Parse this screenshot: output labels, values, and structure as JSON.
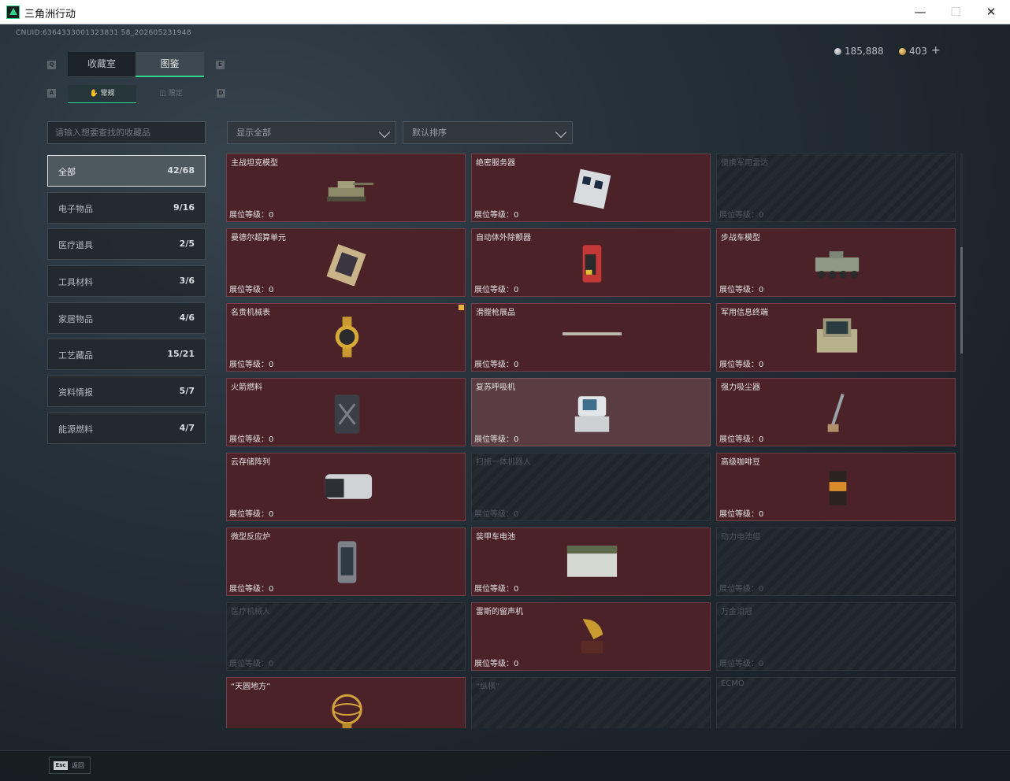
{
  "window": {
    "title": "三角洲行动"
  },
  "header": {
    "uid": "CNUID:6364333001323831 58_202605231948",
    "currency_silver": "185,888",
    "currency_gold": "403",
    "add_label": "+"
  },
  "tabs": {
    "collection": "收藏室",
    "catalog": "图鉴",
    "key_prev": "Q",
    "key_next": "E"
  },
  "subtabs": {
    "normal": "常规",
    "limited": "限定",
    "key_prev": "A",
    "key_next": "D"
  },
  "search": {
    "placeholder": "请输入想要查找的收藏品"
  },
  "filters": {
    "show": "显示全部",
    "sort": "默认排序"
  },
  "categories": [
    {
      "label": "全部",
      "count": "42/68"
    },
    {
      "label": "电子物品",
      "count": "9/16"
    },
    {
      "label": "医疗道具",
      "count": "2/5"
    },
    {
      "label": "工具材料",
      "count": "3/6"
    },
    {
      "label": "家居物品",
      "count": "4/6"
    },
    {
      "label": "工艺藏品",
      "count": "15/21"
    },
    {
      "label": "资料情报",
      "count": "5/7"
    },
    {
      "label": "能源燃料",
      "count": "4/7"
    }
  ],
  "level_prefix": "展位等级：",
  "items": [
    {
      "name": "主战坦克模型",
      "level": "0",
      "owned": true,
      "icon": "tank-model-icon"
    },
    {
      "name": "绝密服务器",
      "level": "0",
      "owned": true,
      "icon": "server-icon"
    },
    {
      "name": "便携军用雷达",
      "level": "0",
      "owned": false,
      "icon": "radar-icon"
    },
    {
      "name": "曼德尔超算单元",
      "level": "0",
      "owned": true,
      "icon": "compute-unit-icon"
    },
    {
      "name": "自动体外除颤器",
      "level": "0",
      "owned": true,
      "icon": "defibrillator-icon"
    },
    {
      "name": "步战车模型",
      "level": "0",
      "owned": true,
      "icon": "ifv-model-icon"
    },
    {
      "name": "名贵机械表",
      "level": "0",
      "owned": true,
      "icon": "watch-icon",
      "new": true
    },
    {
      "name": "滑膛枪展品",
      "level": "0",
      "owned": true,
      "icon": "musket-icon"
    },
    {
      "name": "军用信息终端",
      "level": "0",
      "owned": true,
      "icon": "terminal-icon"
    },
    {
      "name": "火箭燃料",
      "level": "0",
      "owned": true,
      "icon": "fuel-can-icon"
    },
    {
      "name": "复苏呼吸机",
      "level": "0",
      "owned": true,
      "icon": "ventilator-icon",
      "highlight": true
    },
    {
      "name": "强力吸尘器",
      "level": "0",
      "owned": true,
      "icon": "vacuum-icon"
    },
    {
      "name": "云存储阵列",
      "level": "0",
      "owned": true,
      "icon": "storage-array-icon"
    },
    {
      "name": "扫拖一体机器人",
      "level": "0",
      "owned": false,
      "icon": "robot-vacuum-icon"
    },
    {
      "name": "高级咖啡豆",
      "level": "0",
      "owned": true,
      "icon": "coffee-bag-icon"
    },
    {
      "name": "微型反应炉",
      "level": "0",
      "owned": true,
      "icon": "reactor-icon"
    },
    {
      "name": "装甲车电池",
      "level": "0",
      "owned": true,
      "icon": "battery-icon"
    },
    {
      "name": "动力电池组",
      "level": "0",
      "owned": false,
      "icon": "battery-pack-icon"
    },
    {
      "name": "医疗机械人",
      "level": "0",
      "owned": false,
      "icon": "medical-robot-icon"
    },
    {
      "name": "雷斯的留声机",
      "level": "0",
      "owned": true,
      "icon": "gramophone-icon"
    },
    {
      "name": "万金泪冠",
      "level": "0",
      "owned": false,
      "icon": "crown-icon"
    },
    {
      "name": "“天圆地方”",
      "level": "",
      "owned": true,
      "icon": "armillary-sphere-icon"
    },
    {
      "name": "“纵横”",
      "level": "",
      "owned": false,
      "icon": "board-icon"
    },
    {
      "name": "ECMO",
      "level": "",
      "owned": false,
      "icon": "ecmo-icon"
    }
  ],
  "footer": {
    "esc_key": "Esc",
    "esc_label": "返回"
  },
  "colors": {
    "accent": "#2fd58a",
    "owned_card": "#4b2228",
    "locked_card": "#1f262b",
    "new_flag": "#e8b23c"
  }
}
